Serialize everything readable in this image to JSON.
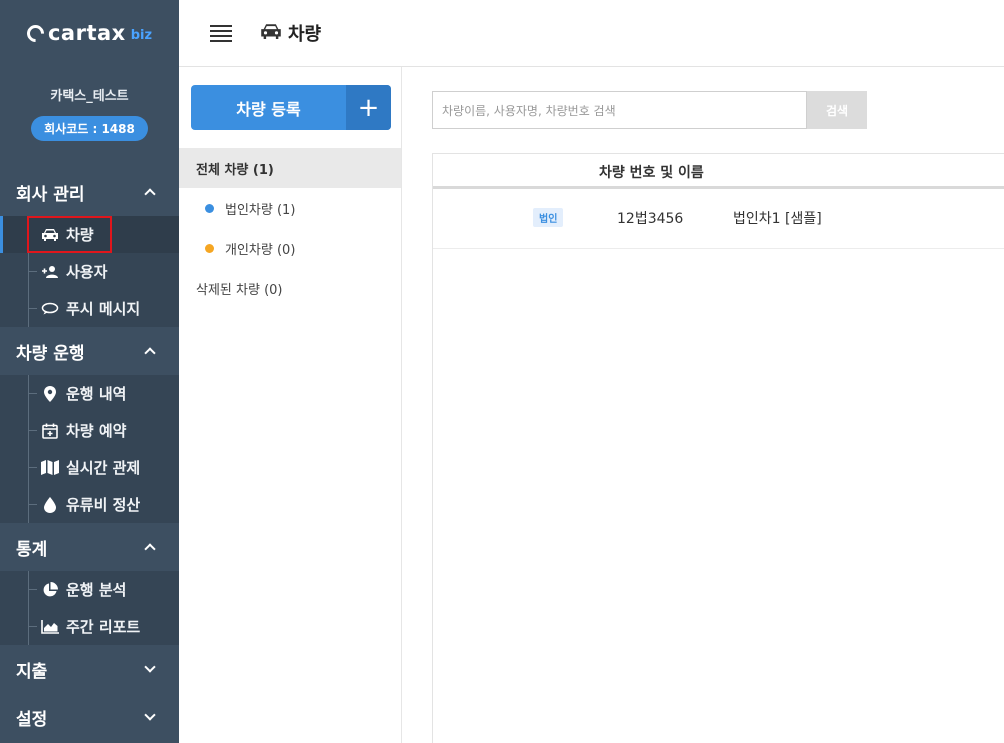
{
  "brand": {
    "logo_text": "cartax",
    "logo_suffix": "biz"
  },
  "company": {
    "name": "카택스_테스트",
    "code": "회사코드 : 1488"
  },
  "sidebar": {
    "sections": [
      {
        "title": "회사 관리",
        "expanded": true,
        "items": [
          {
            "label": "차량",
            "icon": "car-icon",
            "active": true
          },
          {
            "label": "사용자",
            "icon": "user-add-icon"
          },
          {
            "label": "푸시 메시지",
            "icon": "chat-bubble-icon"
          }
        ]
      },
      {
        "title": "차량 운행",
        "expanded": true,
        "items": [
          {
            "label": "운행 내역",
            "icon": "map-pin-icon"
          },
          {
            "label": "차량 예약",
            "icon": "calendar-plus-icon"
          },
          {
            "label": "실시간 관제",
            "icon": "map-icon"
          },
          {
            "label": "유류비 정산",
            "icon": "droplet-icon"
          }
        ]
      },
      {
        "title": "통계",
        "expanded": true,
        "items": [
          {
            "label": "운행 분석",
            "icon": "pie-chart-icon"
          },
          {
            "label": "주간 리포트",
            "icon": "area-chart-icon"
          }
        ]
      },
      {
        "title": "지출",
        "expanded": false,
        "items": []
      },
      {
        "title": "설정",
        "expanded": false,
        "items": []
      }
    ]
  },
  "topbar": {
    "title": "차량"
  },
  "panel": {
    "register_label": "차량 등록",
    "register_plus": "+",
    "filters": {
      "all": "전체 차량 (1)",
      "corporate": "법인차량 (1)",
      "personal": "개인차량 (0)",
      "deleted": "삭제된 차량 (0)"
    }
  },
  "colors": {
    "accent": "#3b8fe0",
    "sidebar": "#3d4f61",
    "corporate_dot": "#3b8fe0",
    "personal_dot": "#f5a623",
    "highlight_box": "#e0161c"
  },
  "search": {
    "placeholder": "차량이름, 사용자명, 차량번호 검색",
    "button": "검색"
  },
  "table": {
    "header": "차량 번호 및 이름",
    "rows": [
      {
        "badge": "법인",
        "number": "12법3456",
        "name": "법인차1 [샘플]"
      }
    ]
  }
}
